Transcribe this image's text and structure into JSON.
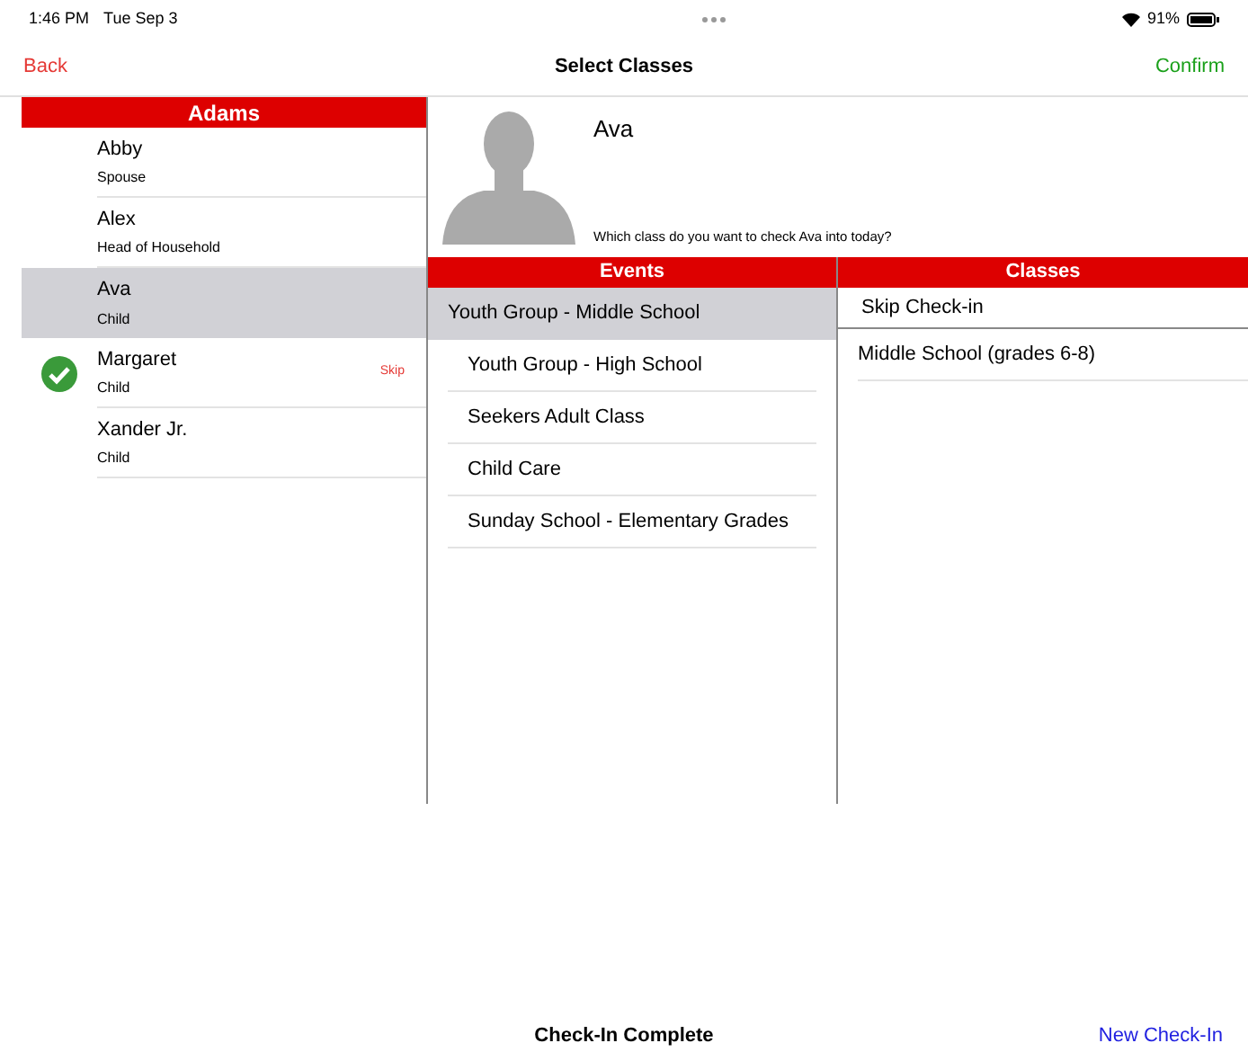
{
  "status_bar": {
    "time": "1:46 PM",
    "date": "Tue Sep 3",
    "battery": "91%"
  },
  "nav": {
    "back": "Back",
    "title": "Select Classes",
    "confirm": "Confirm"
  },
  "family": {
    "name": "Adams",
    "members": [
      {
        "name": "Abby",
        "role": "Spouse",
        "selected": false,
        "checked_in": false
      },
      {
        "name": "Alex",
        "role": "Head of Household",
        "selected": false,
        "checked_in": false
      },
      {
        "name": "Ava",
        "role": "Child",
        "selected": true,
        "checked_in": false
      },
      {
        "name": "Margaret",
        "role": "Child",
        "selected": false,
        "checked_in": true,
        "action": "Skip"
      },
      {
        "name": "Xander Jr.",
        "role": "Child",
        "selected": false,
        "checked_in": false
      }
    ]
  },
  "person": {
    "name": "Ava",
    "prompt": "Which class do you want to check Ava into today?"
  },
  "events": {
    "title": "Events",
    "items": [
      {
        "label": "Youth Group - Middle School",
        "selected": true
      },
      {
        "label": "Youth Group - High School",
        "selected": false
      },
      {
        "label": "Seekers Adult Class",
        "selected": false
      },
      {
        "label": "Child Care",
        "selected": false
      },
      {
        "label": "Sunday School - Elementary Grades",
        "selected": false
      }
    ]
  },
  "classes": {
    "title": "Classes",
    "items": [
      {
        "label": "Skip Check-in",
        "kind": "skip"
      },
      {
        "label": "Middle School (grades 6-8)",
        "kind": "class"
      }
    ]
  },
  "footer": {
    "status": "Check-In Complete",
    "action": "New Check-In"
  }
}
